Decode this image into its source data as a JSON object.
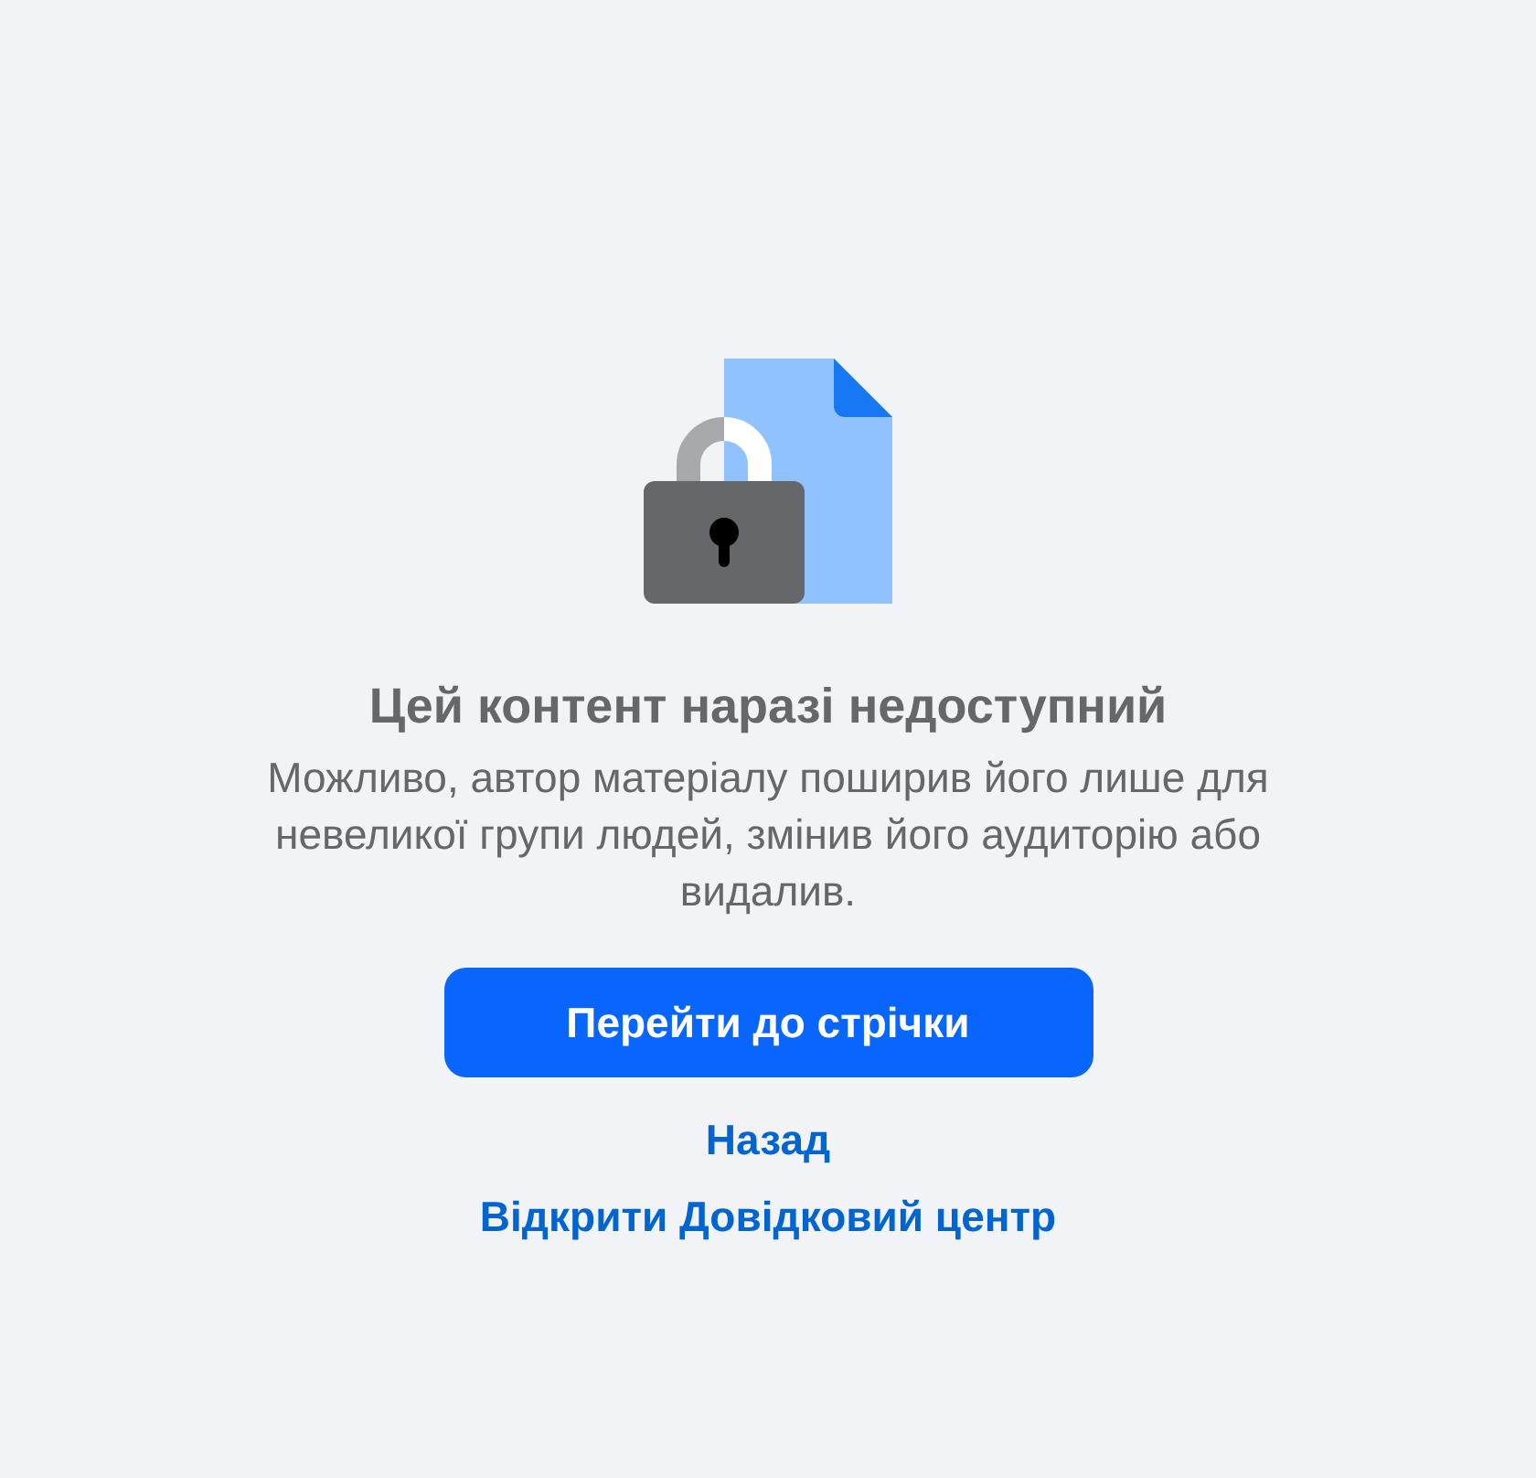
{
  "heading": "Цей контент наразі недоступний",
  "message": "Можливо, автор матеріалу поширив його лише для невеликої групи людей, змінив його аудиторію або видалив.",
  "primary_button": {
    "label": "Перейти до стрічки"
  },
  "links": [
    {
      "label": "Назад"
    },
    {
      "label": "Відкрити Довідковий центр"
    }
  ]
}
